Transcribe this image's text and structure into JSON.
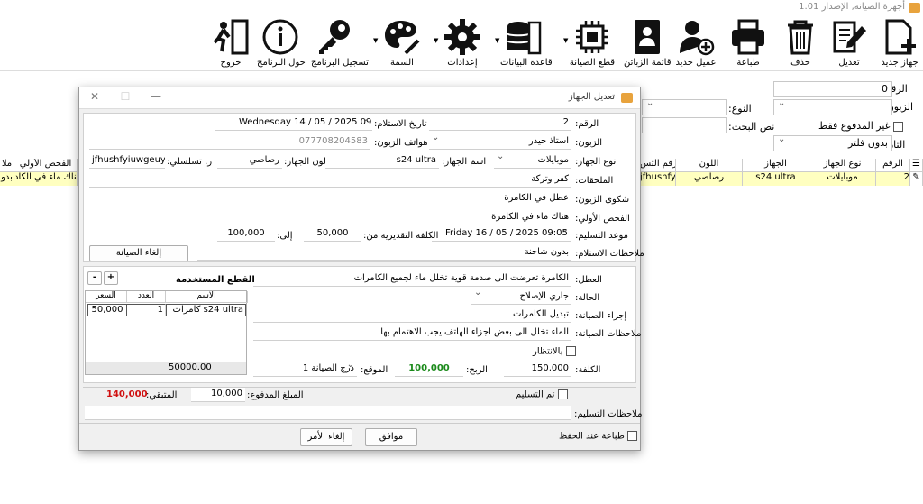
{
  "window": {
    "title": "أجهزة الصيانة, الإصدار 1.01"
  },
  "toolbar": {
    "items": [
      {
        "id": "new",
        "label": "جهاز جديد"
      },
      {
        "id": "edit",
        "label": "تعديل"
      },
      {
        "id": "delete",
        "label": "حذف"
      },
      {
        "id": "print",
        "label": "طباعة"
      },
      {
        "id": "newclient",
        "label": "عميل جديد"
      },
      {
        "id": "clients",
        "label": "قائمة الزبائن"
      },
      {
        "id": "parts",
        "label": "قطع الصيانة"
      },
      {
        "id": "db",
        "label": "قاعدة البيانات"
      },
      {
        "id": "settings",
        "label": "إعدادات"
      },
      {
        "id": "theme",
        "label": "السمة"
      },
      {
        "id": "register",
        "label": "تسجيل البرنامج"
      },
      {
        "id": "about",
        "label": "حول البرنامج"
      },
      {
        "id": "exit",
        "label": "خروج"
      }
    ]
  },
  "filters": {
    "number_label": "الرقم:",
    "number_value": "0",
    "client_label": "الزبون:",
    "type_label": "النوع:",
    "unpaid_label": "غير المدفوع فقط",
    "search_label": "نص البحث:",
    "date_label": "التاريخ:",
    "date_value": "بدون فلتر"
  },
  "grid": {
    "headers": [
      "الرقم",
      "نوع الجهاز",
      "الجهاز",
      "اللون",
      "الرقم التس",
      "الفحص الأولي",
      "ملا"
    ],
    "row": [
      "2",
      "موبايلات",
      "s24 ultra",
      "رصاصي",
      "jfhushfyiuwgeuy",
      "هناك ماء في الكاد",
      "بدو"
    ]
  },
  "dialog": {
    "title": "تعديل الجهاز",
    "number_label": "الرقم:",
    "number_value": "2",
    "receive_date_label": "تاريخ الاستلام:",
    "receive_date_value": "Wednesday 14 / 05 / 2025 09:05 AM",
    "client_label": "الزبون:",
    "client_value": "استاذ حيدر",
    "phone_label": "هواتف الزبون:",
    "phone_value": "077708204583",
    "device_type_label": "نوع الجهاز:",
    "device_type_value": "موبايلات",
    "device_name_label": "اسم الجهاز:",
    "device_name_value": "s24 ultra",
    "color_label": "لون الجهاز:",
    "color_value": "رصاصي",
    "serial_label": "ر. تسلسلي:",
    "serial_value": "jfhushfyiuwgeuy",
    "accessories_label": "الملحقات:",
    "accessories_value": "كفر وتركة",
    "complaint_label": "شكوى الزبون:",
    "complaint_value": "عطل في الكامرة",
    "initial_label": "الفحص الأولي:",
    "initial_value": "هناك ماء في الكامرة",
    "delivery_label": "موعد التسليم:",
    "delivery_value": "Friday 16 / 05 / 2025 09:05 AM",
    "cost_from_label": "الكلفة التقديرية من:",
    "cost_from_value": "50,000",
    "cost_to_label": "إلى:",
    "cost_to_value": "100,000",
    "receive_notes_label": "ملاحظات الاستلام:",
    "receive_notes_value": "بدون شاحنة",
    "cancel_repair_button": "إلغاء الصيانة",
    "fault_label": "العطل:",
    "fault_value": "الكامرة تعرضت الى صدمة قوية تخلل ماء لجميع الكامرات",
    "status_label": "الحالة:",
    "status_value": "جاري الإصلاح",
    "procedure_label": "إجراء الصيانة:",
    "procedure_value": "تبديل الكامرات",
    "repair_notes_label": "ملاحظات الصيانة:",
    "repair_notes_value": "الماء تخلل الى بعض اجزاء الهاتف يجب الاهتمام بها",
    "waiting_label": "بالانتظار",
    "cost_label": "الكلفة:",
    "cost_value": "150,000",
    "profit_label": "الربح:",
    "profit_value": "100,000",
    "location_label": "الموقع:",
    "location_value": "درج الصيانة 1",
    "parts_title": "القطع المستخدمة",
    "parts_headers": [
      "الاسم",
      "العدد",
      "السعر"
    ],
    "parts_rows": [
      {
        "name": "كامرات s24 ultra",
        "qty": "1",
        "price": "50,000"
      }
    ],
    "parts_total": "50000.00",
    "delivered_label": "تم التسليم",
    "paid_label": "المبلغ المدفوع:",
    "paid_value": "10,000",
    "remaining_label": "المتبقي:",
    "remaining_value": "140,000",
    "delivery_notes_label": "ملاحظات التسليم:",
    "print_on_save_label": "طباعة عند الحفظ",
    "ok_button": "موافق",
    "cancel_button": "إلغاء الأمر"
  },
  "colors": {
    "accent": "#e8a33d",
    "profit": "#1a8a1a",
    "remaining": "#d01010",
    "row_highlight": "#ffffc0"
  }
}
